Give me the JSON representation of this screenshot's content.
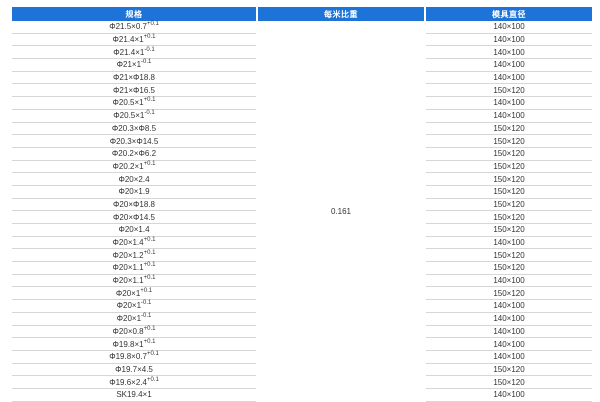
{
  "table": {
    "headers": [
      "规格",
      "每米比重",
      "模具直径"
    ],
    "density": "0.161",
    "rows": [
      {
        "spec": "Φ21.5×0.7",
        "sup": "+0.1",
        "die": "140×100"
      },
      {
        "spec": "Φ21.4×1",
        "sup": "+0.1",
        "die": "140×100"
      },
      {
        "spec": "Φ21.4×1",
        "sup": "-0.1",
        "die": "140×100"
      },
      {
        "spec": "Φ21×1",
        "sup": "-0.1",
        "die": "140×100"
      },
      {
        "spec": "Φ21×Φ18.8",
        "sup": "",
        "die": "140×100"
      },
      {
        "spec": "Φ21×Φ16.5",
        "sup": "",
        "die": "150×120"
      },
      {
        "spec": "Φ20.5×1",
        "sup": "+0.1",
        "die": "140×100"
      },
      {
        "spec": "Φ20.5×1",
        "sup": "-0.1",
        "die": "140×100"
      },
      {
        "spec": "Φ20.3×Φ8.5",
        "sup": "",
        "die": "150×120"
      },
      {
        "spec": "Φ20.3×Φ14.5",
        "sup": "",
        "die": "150×120"
      },
      {
        "spec": "Φ20.2×Φ6.2",
        "sup": "",
        "die": "150×120"
      },
      {
        "spec": "Φ20.2×1",
        "sup": "+0.1",
        "die": "150×120"
      },
      {
        "spec": "Φ20×2.4",
        "sup": "",
        "die": "150×120"
      },
      {
        "spec": "Φ20×1.9",
        "sup": "",
        "die": "150×120"
      },
      {
        "spec": "Φ20×Φ18.8",
        "sup": "",
        "die": "150×120"
      },
      {
        "spec": "Φ20×Φ14.5",
        "sup": "",
        "die": "150×120"
      },
      {
        "spec": "Φ20×1.4",
        "sup": "",
        "die": "150×120"
      },
      {
        "spec": "Φ20×1.4",
        "sup": "+0.1",
        "die": "140×100"
      },
      {
        "spec": "Φ20×1.2",
        "sup": "+0.1",
        "die": "150×120"
      },
      {
        "spec": "Φ20×1.1",
        "sup": "+0.1",
        "die": "150×120"
      },
      {
        "spec": "Φ20×1.1",
        "sup": "+0.1",
        "die": "140×100"
      },
      {
        "spec": "Φ20×1",
        "sup": "+0.1",
        "die": "150×120"
      },
      {
        "spec": "Φ20×1",
        "sup": "-0.1",
        "die": "140×100"
      },
      {
        "spec": "Φ20×1",
        "sup": "-0.1",
        "die": "140×100"
      },
      {
        "spec": "Φ20×0.8",
        "sup": "+0.1",
        "die": "140×100"
      },
      {
        "spec": "Φ19.8×1",
        "sup": "+0.1",
        "die": "140×100"
      },
      {
        "spec": "Φ19.8×0.7",
        "sup": "+0.1",
        "die": "140×100"
      },
      {
        "spec": "Φ19.7×4.5",
        "sup": "",
        "die": "150×120"
      },
      {
        "spec": "Φ19.6×2.4",
        "sup": "+0.1",
        "die": "150×120"
      },
      {
        "spec": "SK19.4×1",
        "sup": "",
        "die": "140×100"
      }
    ]
  }
}
